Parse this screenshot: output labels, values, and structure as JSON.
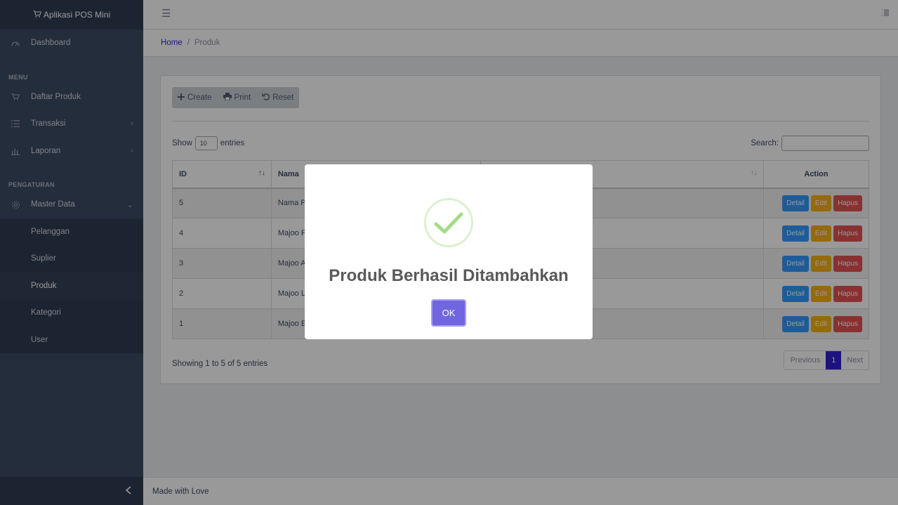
{
  "app": {
    "title": "Aplikasi POS Mini"
  },
  "sidebar": {
    "dashboard": "Dashboard",
    "menu_title": "MENU",
    "menu_items": [
      {
        "label": "Daftar Produk",
        "icon": "cart-icon"
      },
      {
        "label": "Transaksi",
        "icon": "list-icon"
      },
      {
        "label": "Laporan",
        "icon": "chart-bar-icon"
      }
    ],
    "settings_title": "PENGATURAN",
    "master_data": "Master Data",
    "sub_items": [
      "Pelanggan",
      "Suplier",
      "Produk",
      "Kategori",
      "User"
    ],
    "active_sub": "Produk"
  },
  "breadcrumb": {
    "home": "Home",
    "sep": "/",
    "current": "Produk"
  },
  "toolbar": {
    "create": "Create",
    "print": "Print",
    "reset": "Reset"
  },
  "table_controls": {
    "show": "Show",
    "length_value": "10",
    "entries": "entries",
    "search_label": "Search:",
    "search_value": ""
  },
  "table": {
    "headers": {
      "id": "ID",
      "nama": "Nama",
      "action": "Action"
    },
    "rows": [
      {
        "id": "5",
        "nama": "Nama P"
      },
      {
        "id": "4",
        "nama": "Majoo P"
      },
      {
        "id": "3",
        "nama": "Majoo A"
      },
      {
        "id": "2",
        "nama": "Majoo L"
      },
      {
        "id": "1",
        "nama": "Majoo E"
      }
    ],
    "action_labels": {
      "detail": "Detail",
      "edit": "Edit",
      "hapus": "Hapus"
    }
  },
  "pagination": {
    "info": "Showing 1 to 5 of 5 entries",
    "previous": "Previous",
    "current_page": "1",
    "next": "Next"
  },
  "footer": {
    "text": "Made with Love"
  },
  "modal": {
    "title": "Produk Berhasil Ditambahkan",
    "ok": "OK"
  },
  "colors": {
    "sidebar": "#3c4b64",
    "primary": "#321fdb",
    "detail": "#3399ff",
    "edit": "#f9b115",
    "hapus": "#e55353",
    "ok": "#7066e0",
    "success": "#a5dc86"
  }
}
